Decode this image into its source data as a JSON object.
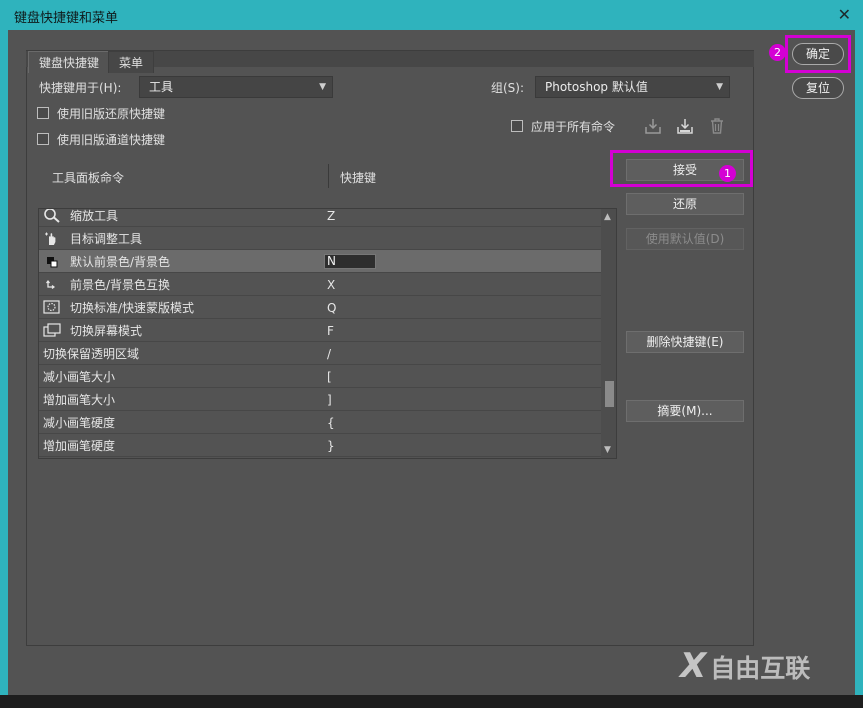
{
  "window": {
    "title": "键盘快捷键和菜单",
    "close_glyph": "✕"
  },
  "tabs": [
    {
      "label": "键盘快捷键",
      "active": true
    },
    {
      "label": "菜单",
      "active": false
    }
  ],
  "shortcuts_for": {
    "label": "快捷键用于(H):",
    "value": "工具"
  },
  "group": {
    "label": "组(S):",
    "value": "Photoshop 默认值"
  },
  "checkboxes": {
    "legacy_undo": {
      "label": "使用旧版还原快捷键",
      "checked": false
    },
    "legacy_channel": {
      "label": "使用旧版通道快捷键",
      "checked": false
    },
    "apply_all": {
      "label": "应用于所有命令",
      "checked": false
    }
  },
  "columns": {
    "command": "工具面板命令",
    "shortcut": "快捷键"
  },
  "rows": [
    {
      "icon": "zoom-icon",
      "name": "缩放工具",
      "key": "Z"
    },
    {
      "icon": "hand-adjust-icon",
      "name": "目标调整工具",
      "key": ""
    },
    {
      "icon": "default-colors-icon",
      "name": "默认前景色/背景色",
      "key": "N",
      "selected": true
    },
    {
      "icon": "swap-colors-icon",
      "name": "前景色/背景色互换",
      "key": "X"
    },
    {
      "icon": "quick-mask-icon",
      "name": "切换标准/快速蒙版模式",
      "key": "Q"
    },
    {
      "icon": "screen-mode-icon",
      "name": "切换屏幕模式",
      "key": "F"
    },
    {
      "icon": "",
      "name": "切换保留透明区域",
      "key": "/"
    },
    {
      "icon": "",
      "name": "减小画笔大小",
      "key": "["
    },
    {
      "icon": "",
      "name": "增加画笔大小",
      "key": "]"
    },
    {
      "icon": "",
      "name": "减小画笔硬度",
      "key": "{"
    },
    {
      "icon": "",
      "name": "增加画笔硬度",
      "key": "}"
    }
  ],
  "buttons": {
    "ok": "确定",
    "reset": "复位",
    "accept": "接受",
    "undo": "还原",
    "use_default": "使用默认值(D)",
    "delete_shortcut": "删除快捷键(E)",
    "summarize": "摘要(M)..."
  },
  "annotations": {
    "badge_1": "1",
    "badge_2": "2",
    "highlight_color": "#d400d4"
  },
  "watermark": {
    "glyph": "X",
    "text": "自由互联"
  },
  "colors": {
    "titlebar": "#2fb3bd",
    "dialog_bg": "#535353",
    "selected_row": "#6b6b6b"
  }
}
